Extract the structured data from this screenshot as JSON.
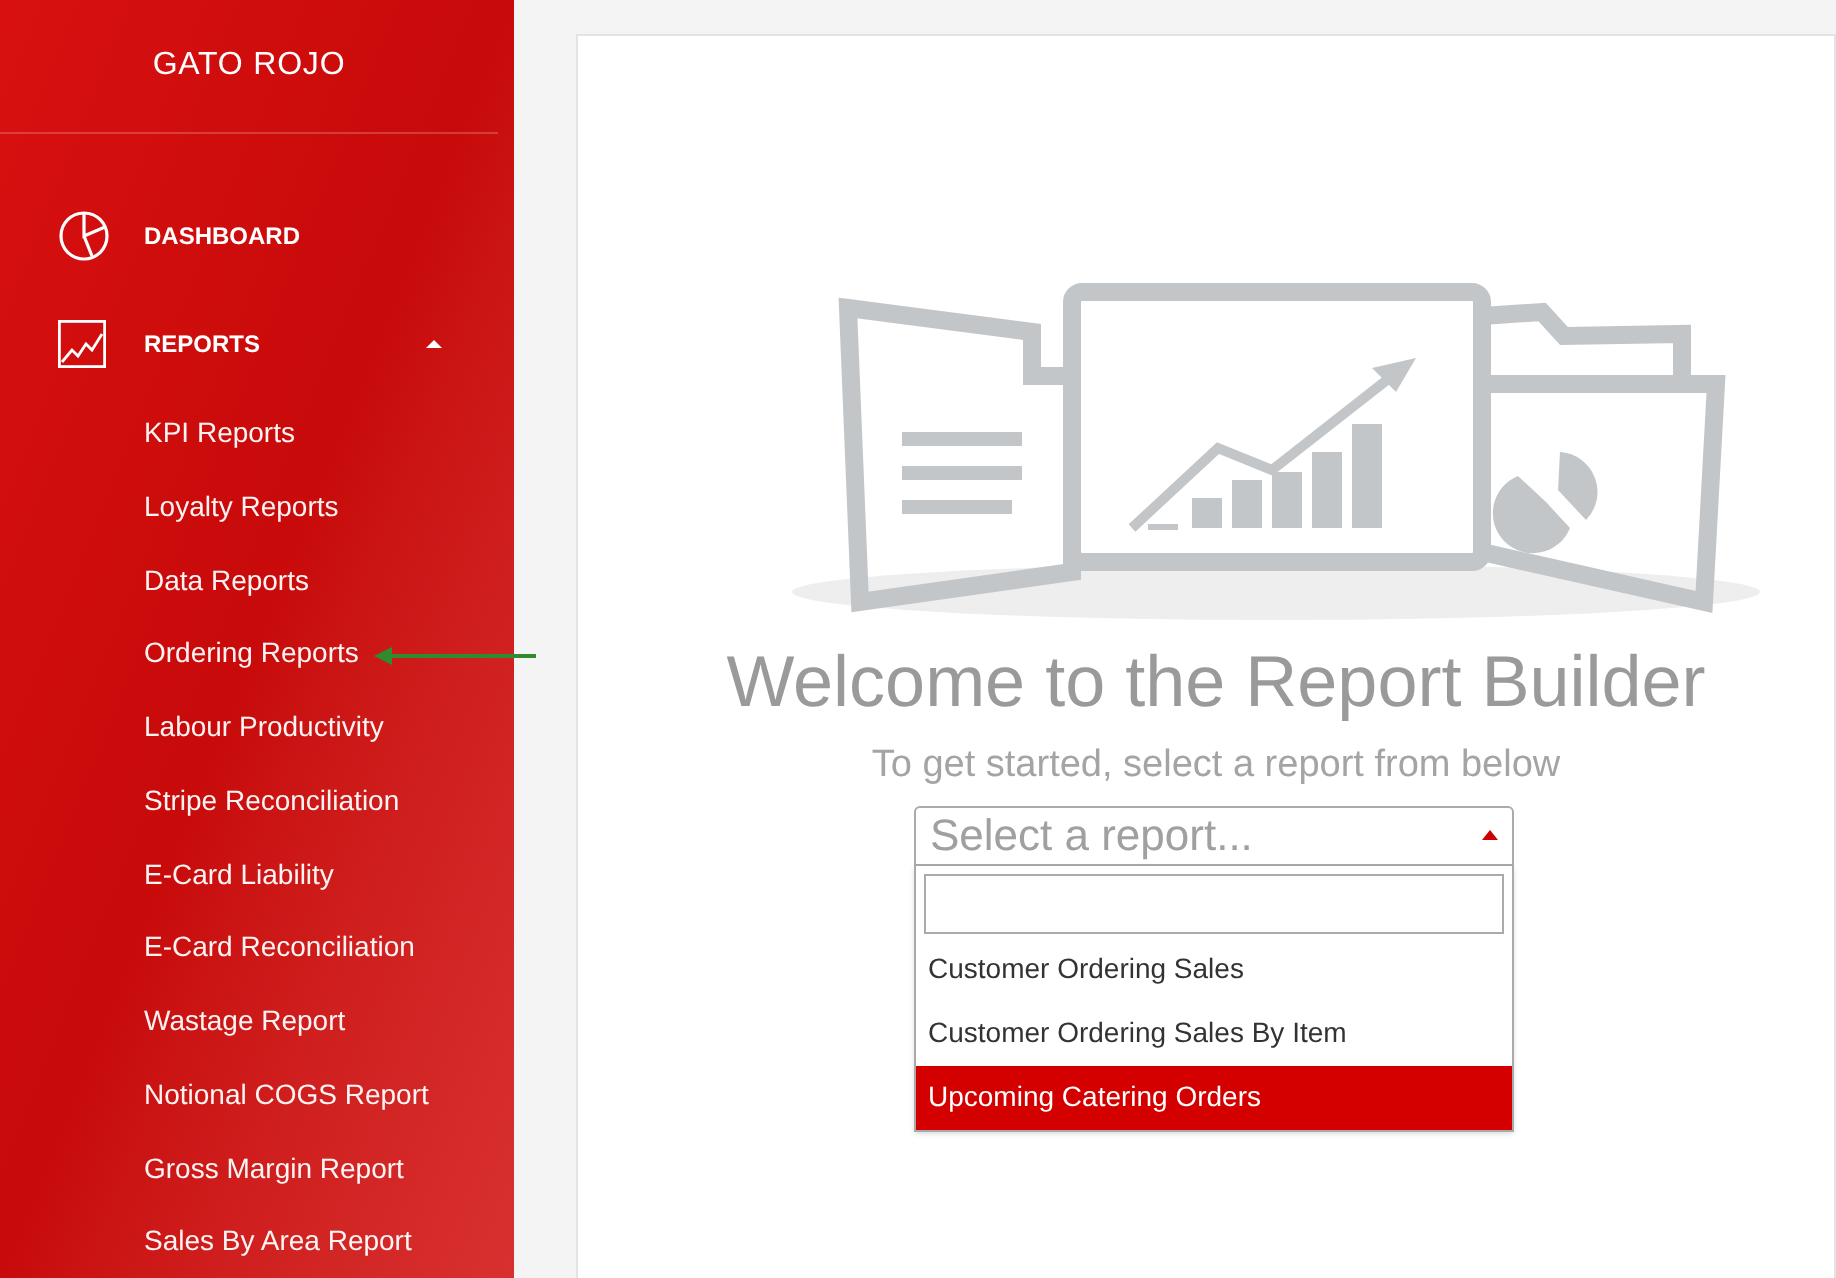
{
  "sidebar": {
    "brand": "GATO ROJO",
    "items": [
      {
        "label": "DASHBOARD",
        "expanded": false
      },
      {
        "label": "REPORTS",
        "expanded": true,
        "children": [
          {
            "label": "KPI Reports",
            "pointed": false
          },
          {
            "label": "Loyalty Reports",
            "pointed": false
          },
          {
            "label": "Data Reports",
            "pointed": false
          },
          {
            "label": "Ordering Reports",
            "pointed": true
          },
          {
            "label": "Labour Productivity",
            "pointed": false
          },
          {
            "label": "Stripe Reconciliation",
            "pointed": false
          },
          {
            "label": "E-Card Liability",
            "pointed": false
          },
          {
            "label": "E-Card Reconciliation",
            "pointed": false
          },
          {
            "label": "Wastage Report",
            "pointed": false
          },
          {
            "label": "Notional COGS Report",
            "pointed": false
          },
          {
            "label": "Gross Margin Report",
            "pointed": false
          },
          {
            "label": "Sales By Area Report",
            "pointed": false
          }
        ]
      }
    ]
  },
  "main": {
    "title": "Welcome to the Report Builder",
    "subtitle": "To get started, select a report from below",
    "report_select": {
      "placeholder": "Select a report...",
      "expanded": true,
      "options": [
        {
          "label": "Customer Ordering Sales",
          "selected": false
        },
        {
          "label": "Customer Ordering Sales By Item",
          "selected": false
        },
        {
          "label": "Upcoming Catering Orders",
          "selected": true
        }
      ]
    }
  }
}
